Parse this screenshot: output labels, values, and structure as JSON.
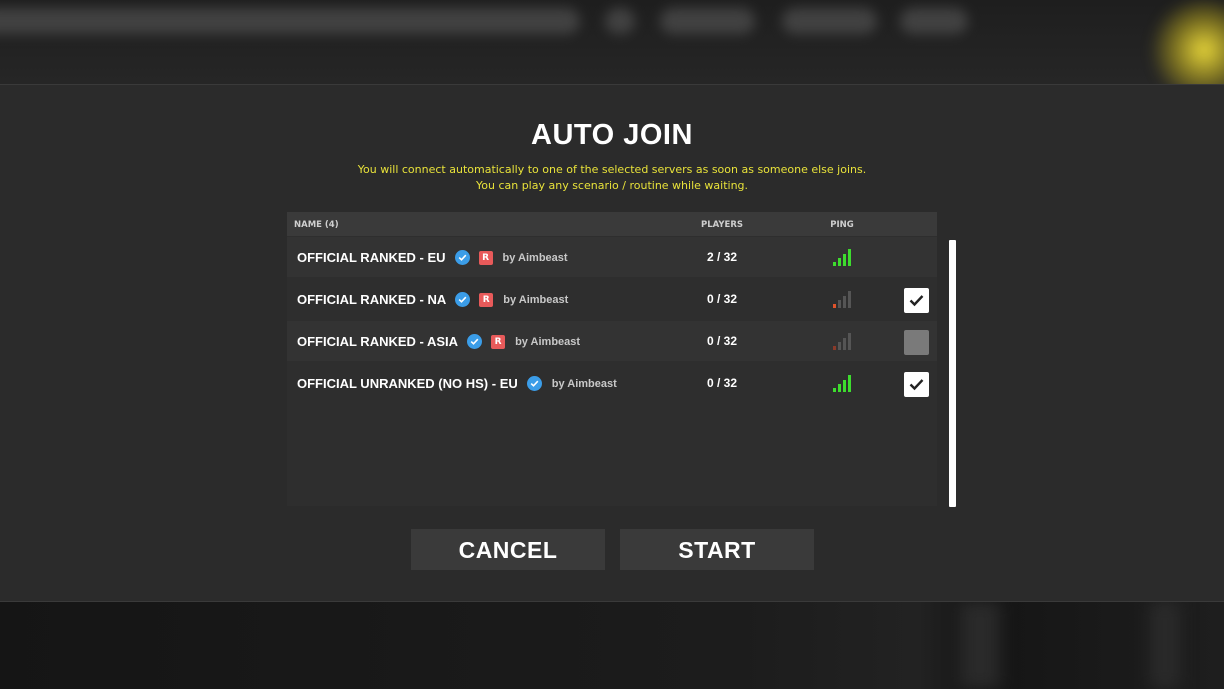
{
  "dialog": {
    "title": "AUTO JOIN",
    "subtitle_line1": "You will connect automatically to one of the selected servers as soon as someone else joins.",
    "subtitle_line2": "You can play any scenario / routine while waiting."
  },
  "table": {
    "columns": {
      "name": "NAME (4)",
      "players": "PLAYERS",
      "ping": "PING"
    },
    "rows": [
      {
        "name": "OFFICIAL RANKED - EU",
        "verified": true,
        "ranked_badge": "R",
        "owner": "by Aimbeast",
        "players": "2 / 32",
        "ping_bars": 4,
        "ping_color": "#3ddc2e",
        "selected": null
      },
      {
        "name": "OFFICIAL RANKED - NA",
        "verified": true,
        "ranked_badge": "R",
        "owner": "by Aimbeast",
        "players": "0 / 32",
        "ping_bars": 1,
        "ping_color": "#e0532b",
        "selected": true
      },
      {
        "name": "OFFICIAL RANKED - ASIA",
        "verified": true,
        "ranked_badge": "R",
        "owner": "by Aimbeast",
        "players": "0 / 32",
        "ping_bars": 1,
        "ping_color": "#8a3a2a",
        "selected": false
      },
      {
        "name": "OFFICIAL UNRANKED (NO HS) - EU",
        "verified": true,
        "ranked_badge": "",
        "owner": "by Aimbeast",
        "players": "0 / 32",
        "ping_bars": 4,
        "ping_color": "#3ddc2e",
        "selected": true
      }
    ]
  },
  "buttons": {
    "cancel": "CANCEL",
    "start": "START"
  },
  "colors": {
    "accent_yellow": "#e8e23a",
    "verified_blue": "#3b9de8",
    "ranked_red": "#e85a5a"
  }
}
